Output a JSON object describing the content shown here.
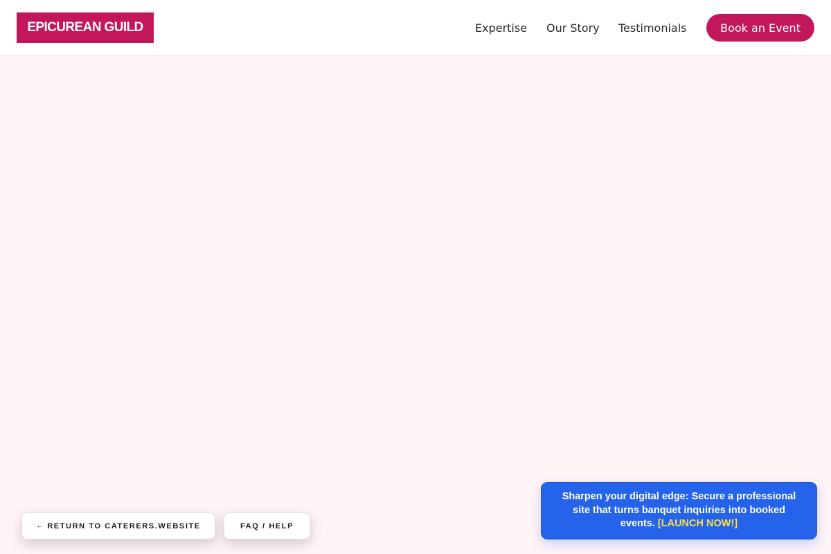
{
  "header": {
    "logo_text": "EPICUREAN GUILD",
    "nav": {
      "expertise": "Expertise",
      "story": "Our Story",
      "testimonials": "Testimonials"
    },
    "cta_label": "Book an Event"
  },
  "footer_pills": {
    "return_arrow": "←",
    "return_label": "RETURN TO CATERERS.WEBSITE",
    "faq_label": "FAQ / HELP"
  },
  "promo": {
    "text": "Sharpen your digital edge: Secure a professional site that turns banquet inquiries into booked events.",
    "link_label": "[LAUNCH NOW!]"
  },
  "colors": {
    "brand": "#c2185b",
    "background": "#fff4f6",
    "promo_bg": "#2563eb",
    "promo_link": "#fde047"
  }
}
